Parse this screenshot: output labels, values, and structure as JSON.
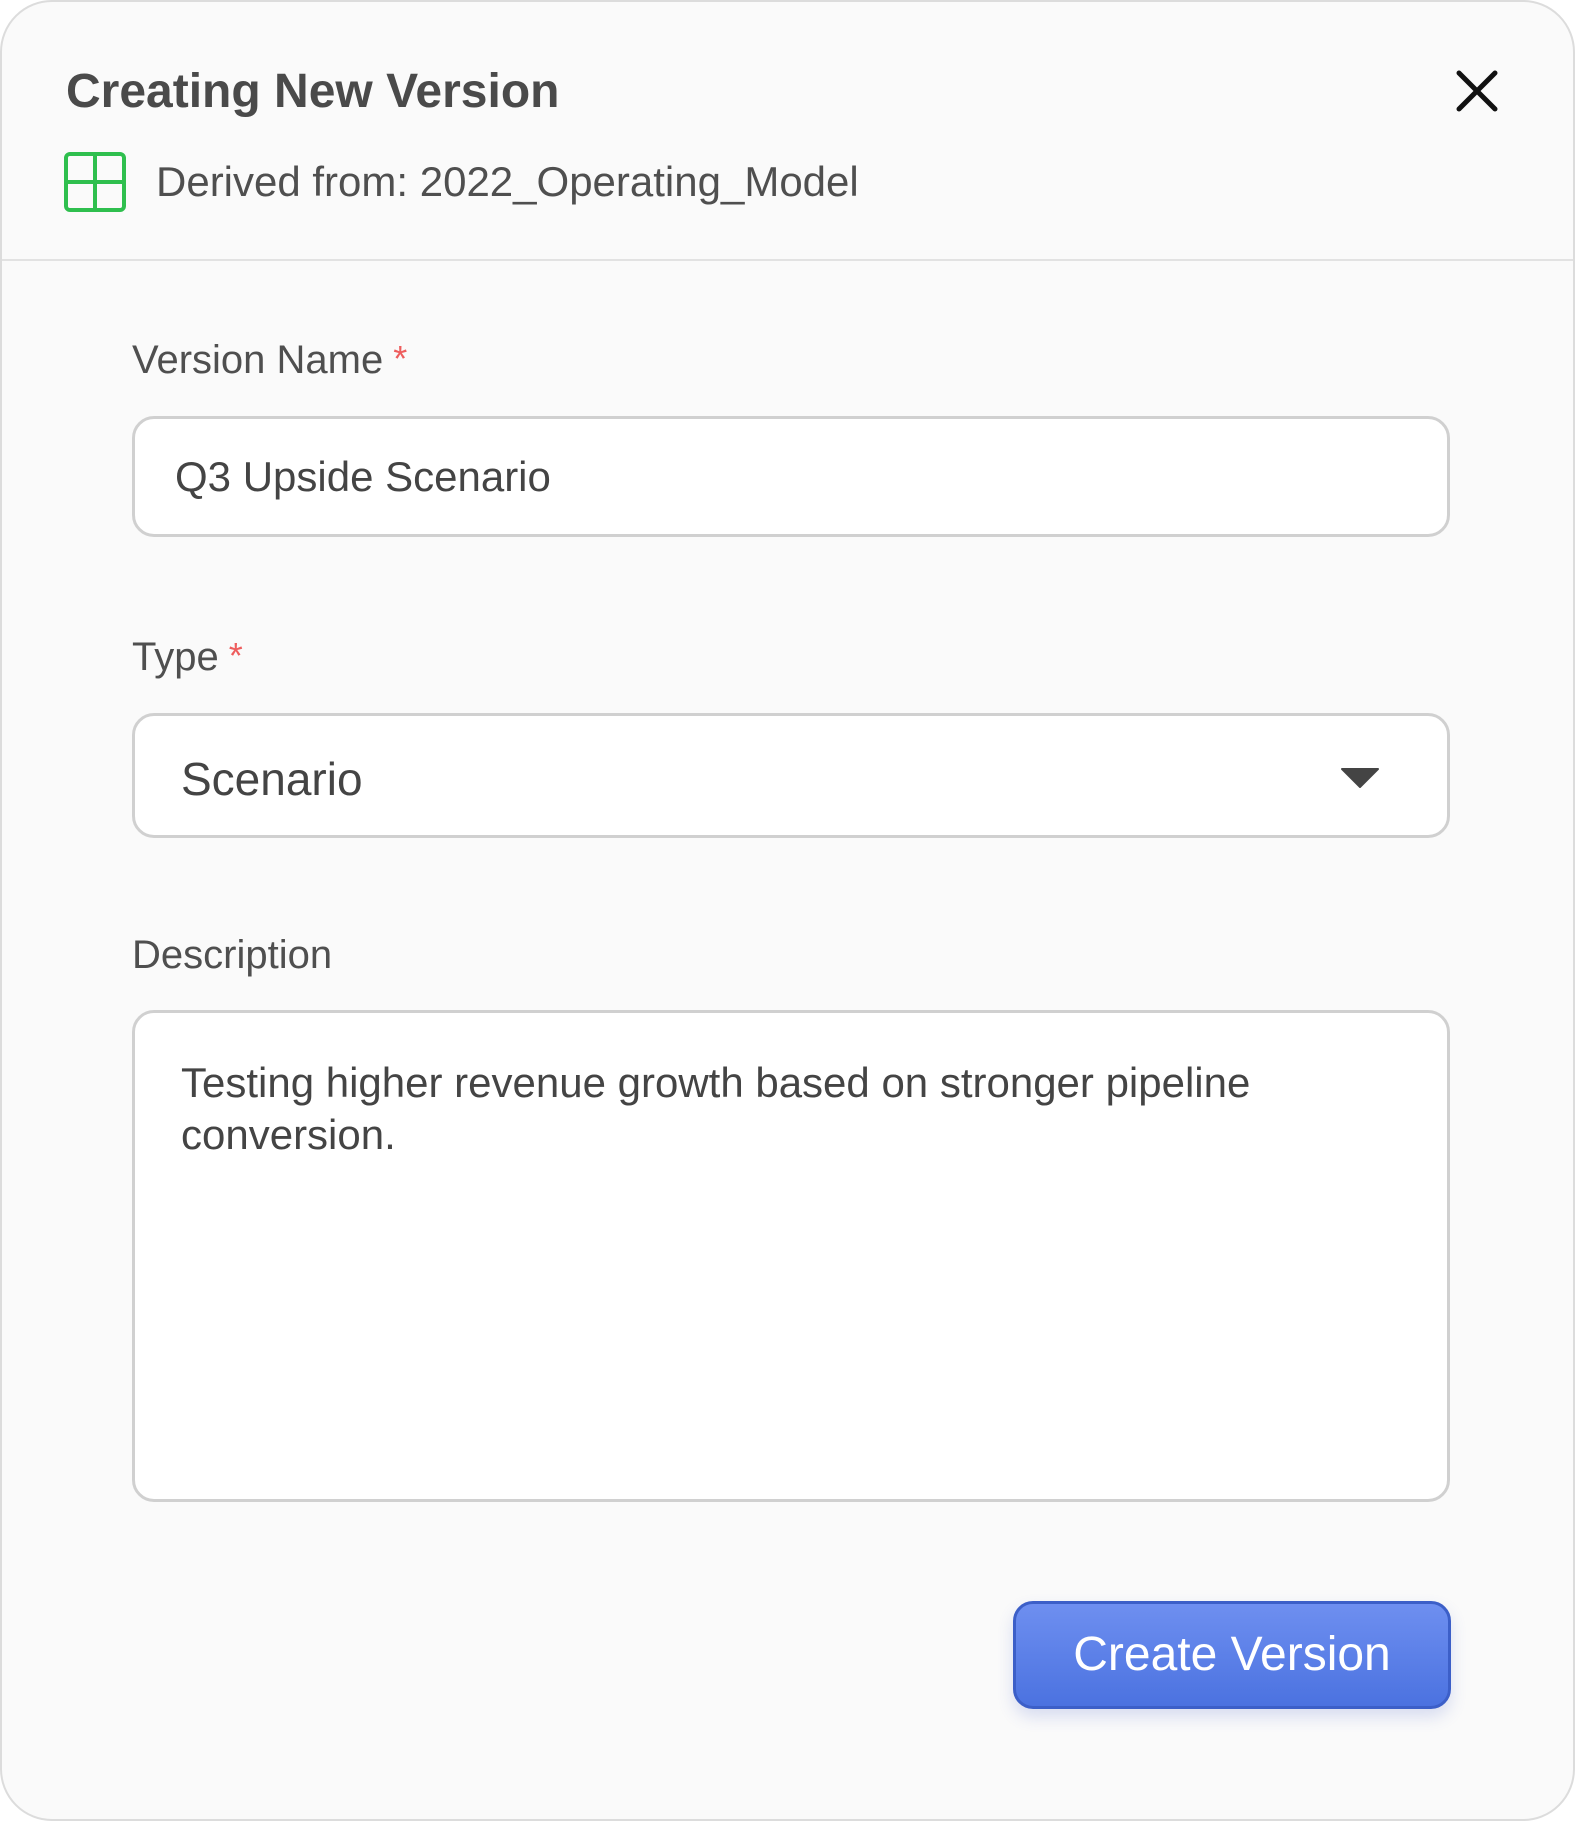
{
  "dialog": {
    "title": "Creating New Version",
    "derived_text": "Derived from: 2022_Operating_Model",
    "derived_icon": "table-grid-icon",
    "close_icon": "close-icon"
  },
  "form": {
    "version_name": {
      "label": "Version Name",
      "required_mark": "*",
      "value": "Q3 Upside Scenario"
    },
    "type": {
      "label": "Type",
      "required_mark": "*",
      "selected": "Scenario"
    },
    "description": {
      "label": "Description",
      "value": "Testing higher revenue growth based on stronger pipeline conversion."
    }
  },
  "actions": {
    "create_label": "Create Version"
  },
  "colors": {
    "accent": "#5079e6",
    "required": "#ee5d5d",
    "icon_green": "#2fbf4e"
  }
}
